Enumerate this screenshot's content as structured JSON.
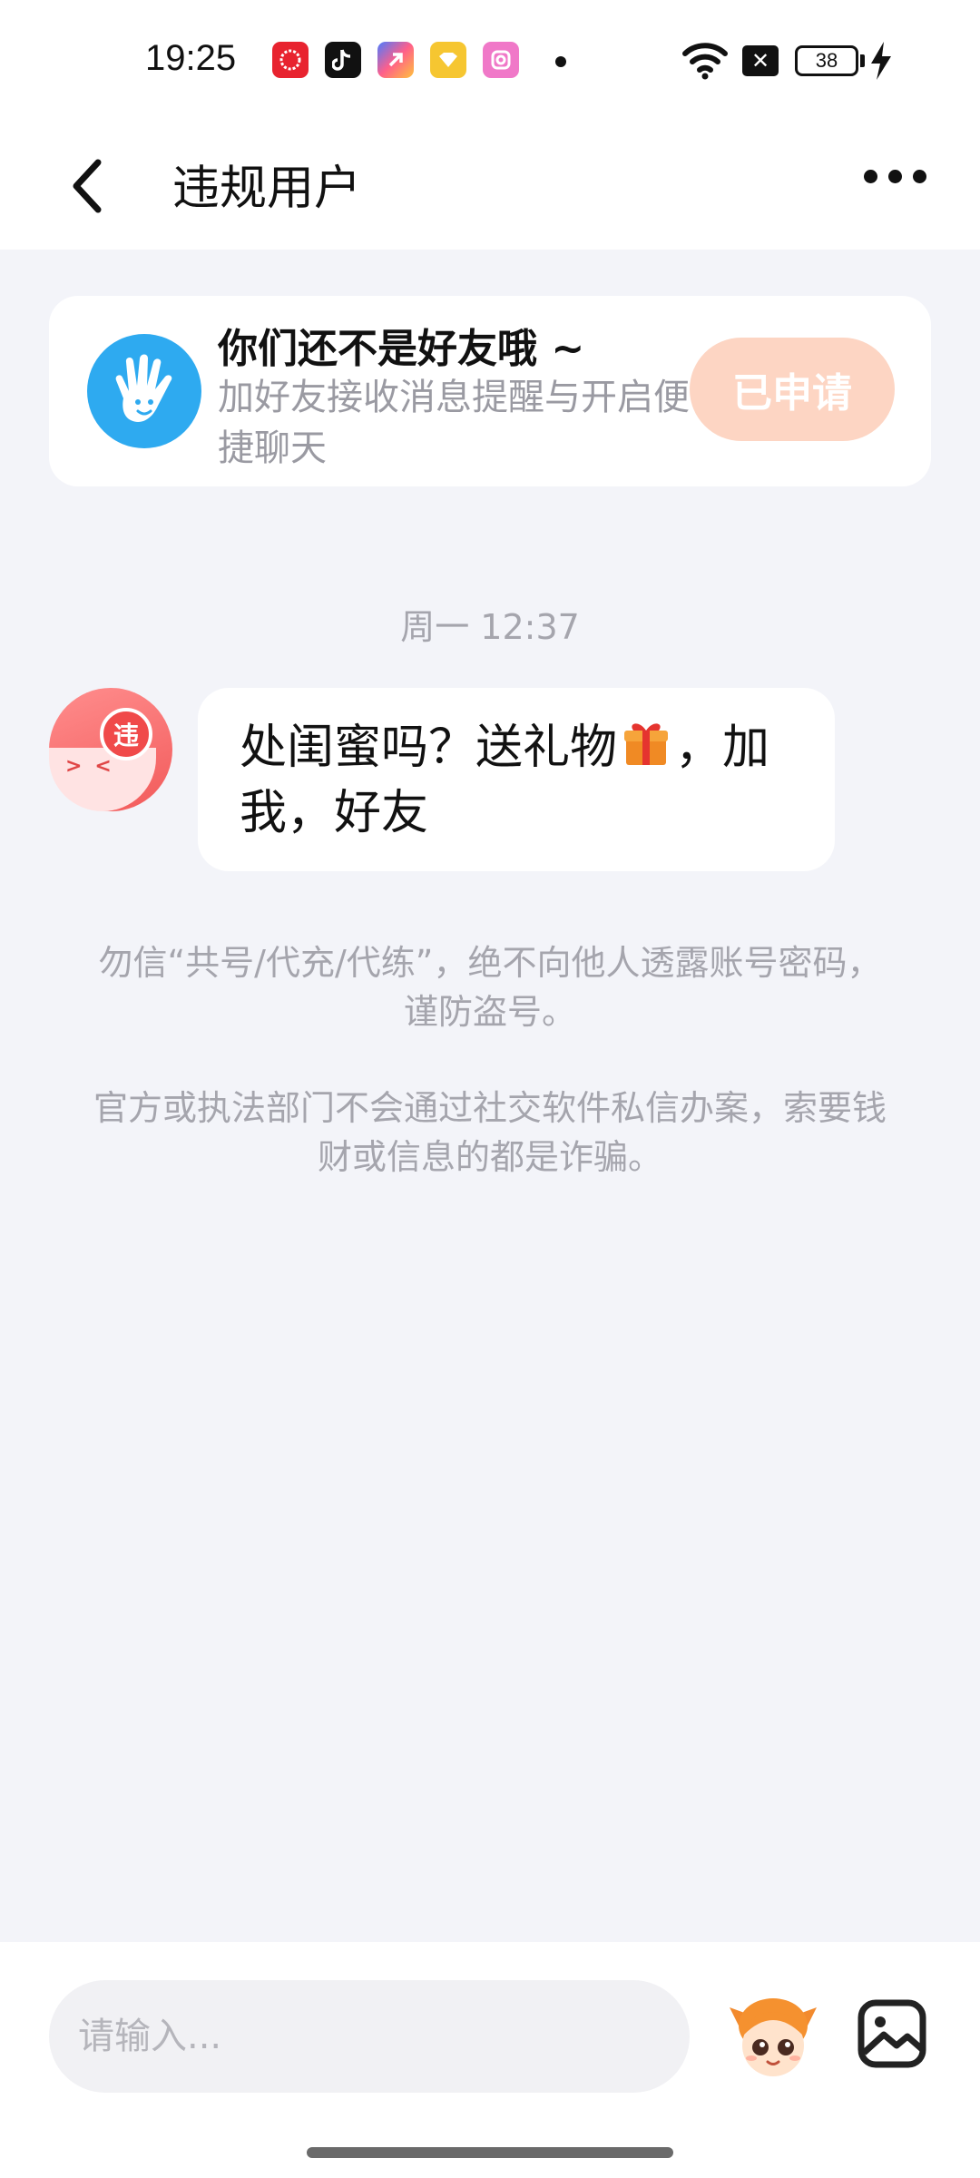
{
  "status_bar": {
    "time": "19:25",
    "battery_level": "38",
    "apps": [
      "red-app-icon",
      "tiktok-icon",
      "gradient-app-icon",
      "yellow-app-icon",
      "pink-app-icon"
    ]
  },
  "header": {
    "title": "违规用户",
    "back_icon": "chevron-left-icon",
    "more_icon": "more-dots-icon"
  },
  "friend_card": {
    "title": "你们还不是好友哦 ~",
    "description": "加好友接收消息提醒与开启便捷聊天",
    "button_label": "已申请"
  },
  "chat": {
    "timestamp": "周一 12:37",
    "avatar_badge": "违",
    "message_before_gift": "处闺蜜吗？送礼物",
    "message_after_gift": "，加我，好友"
  },
  "notices": [
    "勿信“共号/代充/代练”，绝不向他人透露账号密码，谨防盗号。",
    "官方或执法部门不会通过社交软件私信办案，索要钱财或信息的都是诈骗。"
  ],
  "input_bar": {
    "placeholder": "请输入..."
  },
  "colors": {
    "background": "#f3f4f9",
    "applied_button": "#fdd5c3",
    "accent_blue": "#2eaaf0",
    "avatar_red": "#f25a5a"
  }
}
